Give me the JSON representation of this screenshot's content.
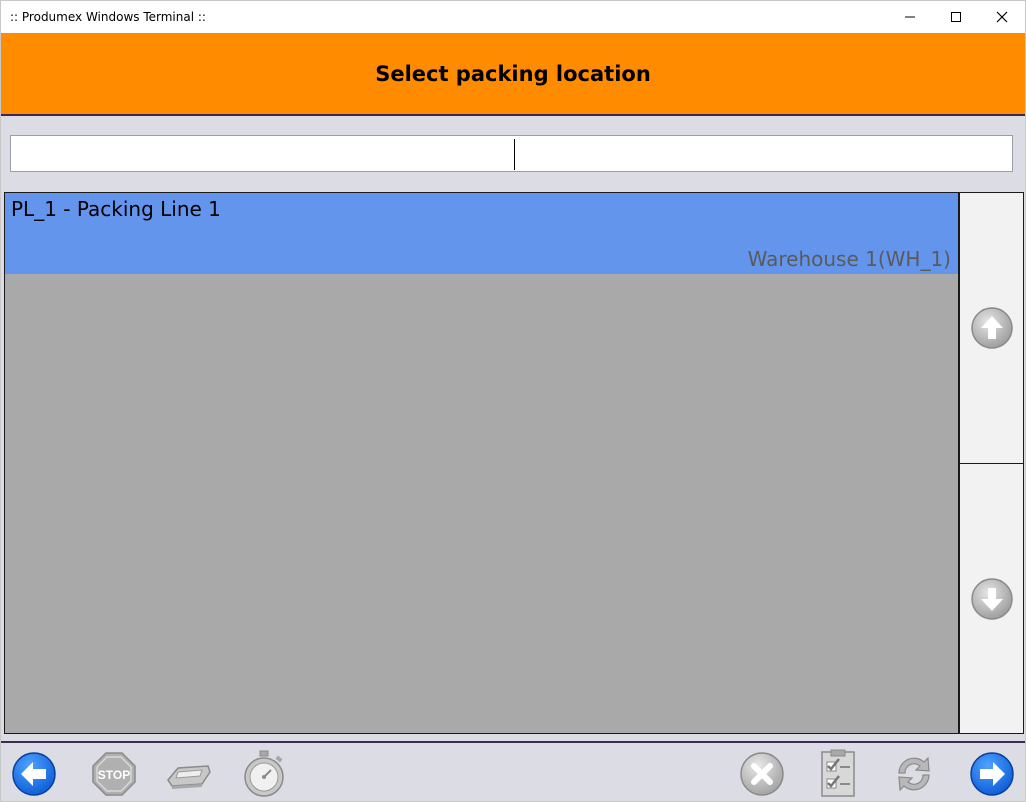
{
  "window": {
    "title": ":: Produmex Windows Terminal ::"
  },
  "header": {
    "title": "Select packing location"
  },
  "search": {
    "value": ""
  },
  "list": {
    "items": [
      {
        "title": "PL_1 - Packing Line 1",
        "subtitle": "Warehouse 1(WH_1)",
        "selected": true
      }
    ]
  },
  "toolbar": {
    "stop_label": "STOP",
    "left": [
      "back-arrow-icon",
      "stop-sign-icon",
      "scanner-icon",
      "stopwatch-icon"
    ],
    "right": [
      "cancel-icon",
      "checklist-icon",
      "refresh-icon",
      "forward-arrow-icon"
    ]
  },
  "colors": {
    "header_bg": "#ff8c00",
    "selected_row": "#6495ed",
    "list_bg": "#a9a9a9",
    "nav_blue": "#1e73e8"
  }
}
